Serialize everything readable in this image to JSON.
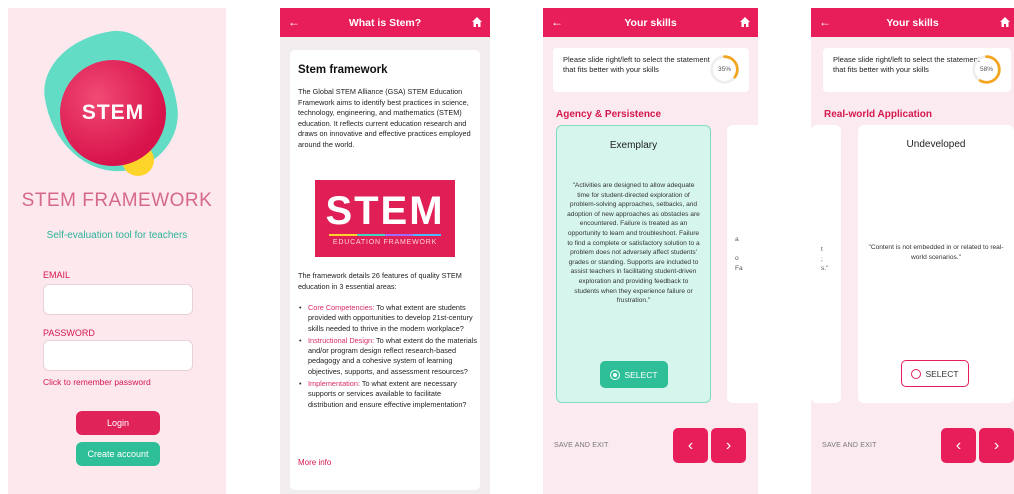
{
  "login": {
    "logo_text": "STEM",
    "title": "STEM FRAMEWORK",
    "subtitle": "Self-evaluation tool for teachers",
    "email_label": "EMAIL",
    "email_value": "",
    "password_label": "PASSWORD",
    "password_value": "",
    "remember_link": "Click to remember password",
    "login_button": "Login",
    "create_button": "Create account"
  },
  "what_is_stem": {
    "header_title": "What is Stem?",
    "heading": "Stem framework",
    "intro": "The Global STEM Alliance (GSA) STEM Education Framework aims to identify best practices in science, technology, engineering, and mathematics (STEM) education. It reflects current education research and draws on innovative and effective practices employed around the world.",
    "banner_big": "STEM",
    "banner_small": "EDUCATION FRAMEWORK",
    "details": "The framework details 26 features of quality STEM education in 3 essential areas:",
    "bullets": [
      {
        "title": "Core Competencies:",
        "text": " To what extent are students provided with opportunities to develop 21st-century skills needed to thrive in the modern workplace?"
      },
      {
        "title": "Instructional Design:",
        "text": " To what extent do the materials and/or program design reflect research-based pedagogy and a cohesive system of learning objectives, supports, and assessment resources?"
      },
      {
        "title": "Implementation:",
        "text": " To what extent are necessary supports or services available to facilitate distribution and ensure effective implementation?"
      }
    ],
    "more_info": "More info"
  },
  "skills_1": {
    "header_title": "Your skills",
    "instruction": "Please slide right/left to select the statement that fits better with your skills",
    "progress_label": "35%",
    "progress_value": 0.35,
    "section": "Agency & Persistence",
    "card_level": "Exemplary",
    "card_text": "\"Activities are designed to allow adequate time for student-directed exploration of problem-solving approaches, setbacks, and adoption of new approaches as obstacles are encountered. Failure is treated as an opportunity to learn and troubleshoot. Failure to find a complete or satisfactory solution to a problem does not adversely affect students' grades or standing. Supports are included to assist teachers in facilitating student-driven exploration and providing feedback to students when they experience failure or frustration.\"",
    "select_label": "SELECT",
    "peek_text": "a\n\no\nFa",
    "save_exit": "SAVE AND EXIT",
    "prev": "‹",
    "next": "›"
  },
  "skills_2": {
    "header_title": "Your skills",
    "instruction": "Please slide right/left to select the statement that fits better with your skills",
    "progress_label": "58%",
    "progress_value": 0.58,
    "section": "Real-world Application",
    "card_level": "Undeveloped",
    "card_text": "\"Content is not embedded in or related to real-world scenarios.\"",
    "select_label": "SELECT",
    "peek_text": "t\n;\ns.\"",
    "save_exit": "SAVE AND EXIT",
    "prev": "‹",
    "next": "›"
  },
  "colors": {
    "brand_pink": "#e81e5a",
    "teal": "#2fbf98",
    "progress_orange": "#f3a51f"
  },
  "icons": [
    "back-arrow-icon",
    "home-icon",
    "radio-icon",
    "chevron-left-icon",
    "chevron-right-icon"
  ]
}
